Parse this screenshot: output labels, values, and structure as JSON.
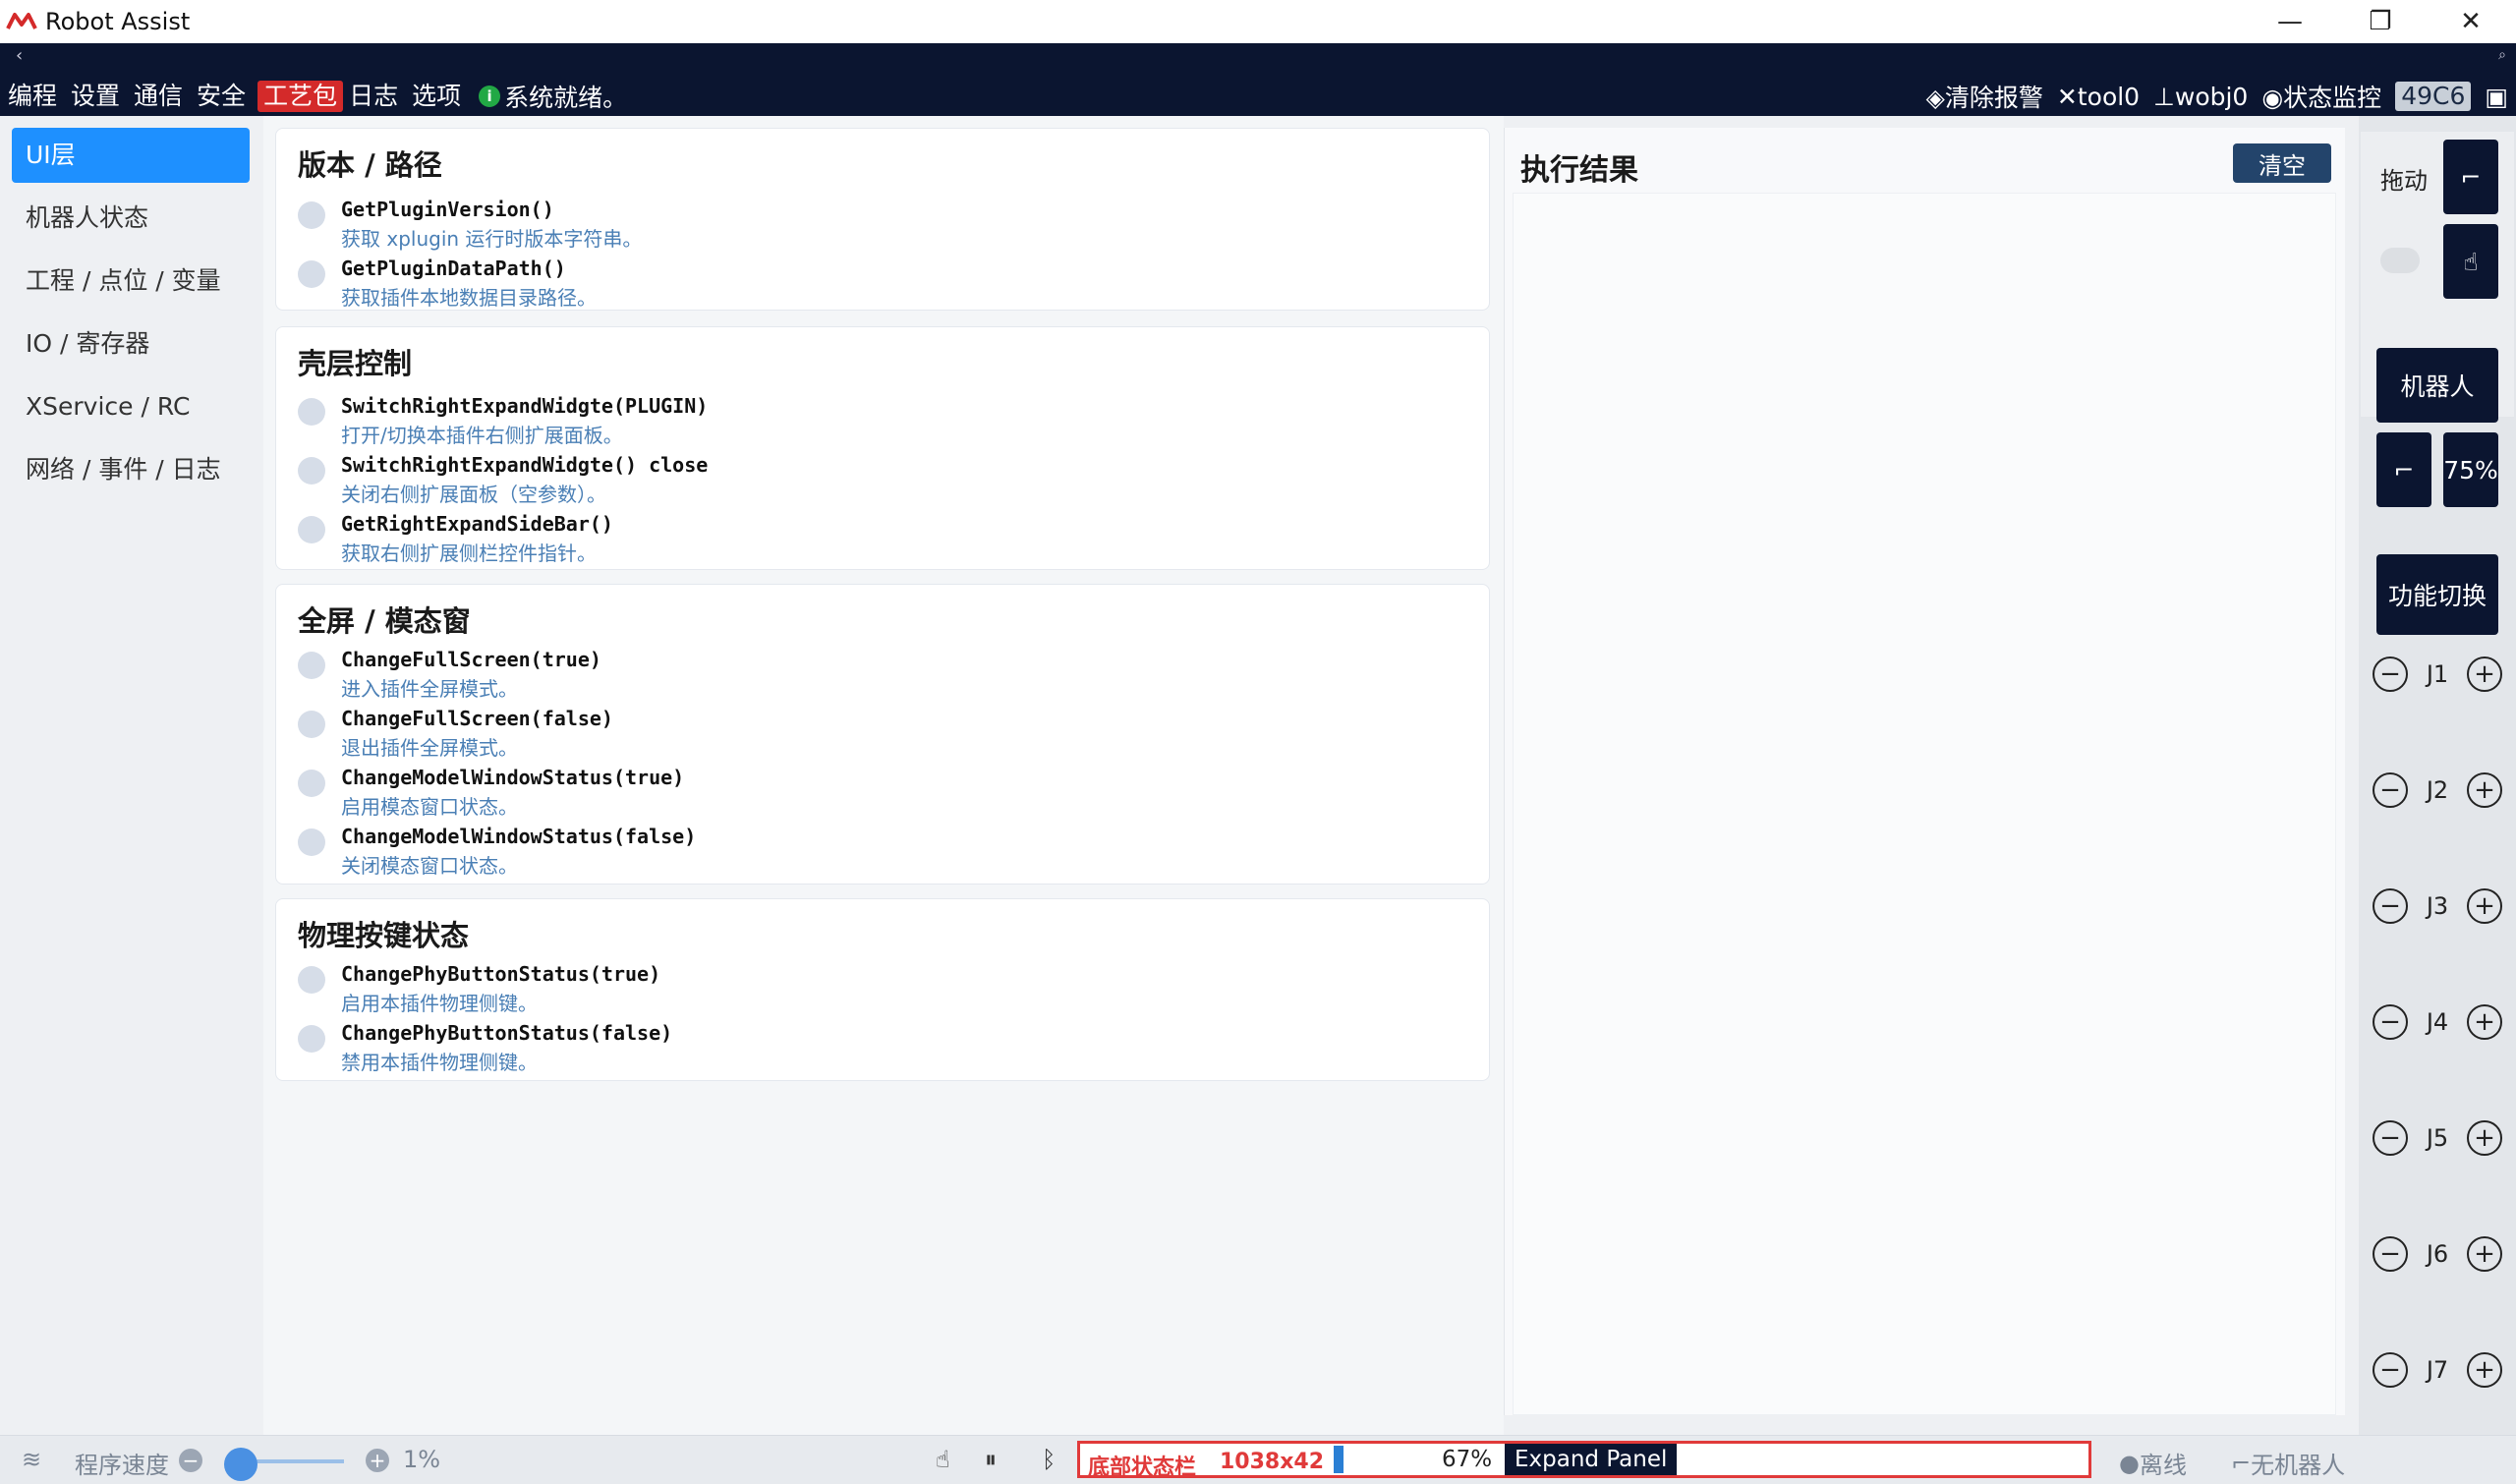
{
  "window": {
    "title": "Robot Assist",
    "minimize": "—",
    "restore": "❐",
    "close": "✕"
  },
  "menubar": {
    "items": [
      "编程",
      "设置",
      "通信",
      "安全",
      "工艺包",
      "日志",
      "选项"
    ],
    "active_item": "工艺包",
    "system_status": "系统就绪。",
    "clear_alarm": "清除报警",
    "tool": "tool0",
    "wobj": "wobj0",
    "status_monitor": "状态监控",
    "code_badge": "49C6"
  },
  "leftnav": {
    "items": [
      "UI层",
      "机器人状态",
      "工程 / 点位 / 变量",
      "IO / 寄存器",
      "XService / RC",
      "网络 / 事件 / 日志"
    ]
  },
  "sections": [
    {
      "title": "版本 / 路径",
      "functions": [
        {
          "name": "GetPluginVersion()",
          "desc": "获取 xplugin 运行时版本字符串。"
        },
        {
          "name": "GetPluginDataPath()",
          "desc": "获取插件本地数据目录路径。"
        }
      ]
    },
    {
      "title": "壳层控制",
      "functions": [
        {
          "name": "SwitchRightExpandWidgte(PLUGIN)",
          "desc": "打开/切换本插件右侧扩展面板。"
        },
        {
          "name": "SwitchRightExpandWidgte() close",
          "desc": "关闭右侧扩展面板（空参数）。"
        },
        {
          "name": "GetRightExpandSideBar()",
          "desc": "获取右侧扩展侧栏控件指针。"
        }
      ]
    },
    {
      "title": "全屏 / 模态窗",
      "functions": [
        {
          "name": "ChangeFullScreen(true)",
          "desc": "进入插件全屏模式。"
        },
        {
          "name": "ChangeFullScreen(false)",
          "desc": "退出插件全屏模式。"
        },
        {
          "name": "ChangeModelWindowStatus(true)",
          "desc": "启用模态窗口状态。"
        },
        {
          "name": "ChangeModelWindowStatus(false)",
          "desc": "关闭模态窗口状态。"
        }
      ]
    },
    {
      "title": "物理按键状态",
      "functions": [
        {
          "name": "ChangePhyButtonStatus(true)",
          "desc": "启用本插件物理侧键。"
        },
        {
          "name": "ChangePhyButtonStatus(false)",
          "desc": "禁用本插件物理侧键。"
        }
      ]
    }
  ],
  "results": {
    "title": "执行结果",
    "clear_label": "清空"
  },
  "rightpanel": {
    "drag_label": "拖动",
    "robot_label": "机器人",
    "speed_percent": "75%",
    "function_switch": "功能切换",
    "joints": [
      "J1",
      "J2",
      "J3",
      "J4",
      "J5",
      "J6",
      "J7"
    ]
  },
  "statusbar": {
    "program_speed_label": "程序速度",
    "program_speed_value": "1%",
    "program_speed_fraction": 0.01,
    "bottom_bar_label": "底部状态栏",
    "bottom_bar_size": "1038x42",
    "bottom_bar_percent": "67%",
    "expand_panel": "Expand Panel",
    "offline": "离线",
    "no_robot": "无机器人"
  },
  "colors": {
    "menubar_bg": "#0b1530",
    "active_menu": "#d42a2a",
    "active_nav": "#1e90ff",
    "ready_dot": "#22a845",
    "desc_text": "#4a7fb5",
    "highlight_box": "#e03a3a"
  }
}
